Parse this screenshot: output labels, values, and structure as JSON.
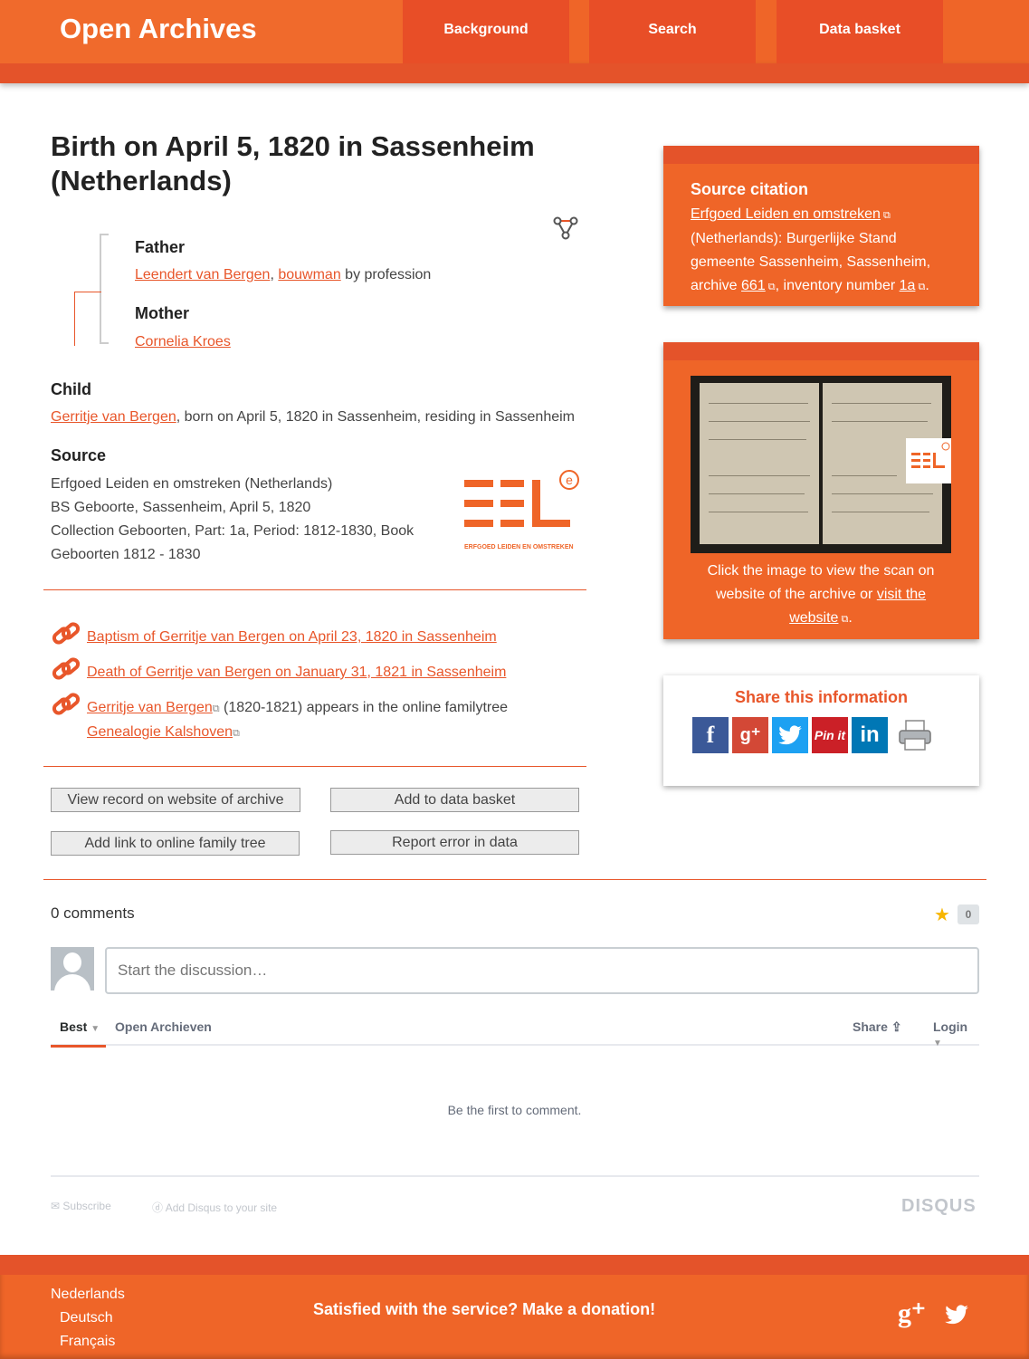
{
  "header": {
    "brand": "Open Archives",
    "nav": [
      "Background",
      "Search",
      "Data basket"
    ]
  },
  "record": {
    "title": "Birth on April 5, 1820 in Sassenheim (Netherlands)",
    "father_label": "Father",
    "father_name": "Leendert van Bergen",
    "father_sep": ", ",
    "father_profession": "bouwman",
    "father_suffix": " by profession",
    "mother_label": "Mother",
    "mother_name": "Cornelia Kroes",
    "child_label": "Child",
    "child_name": "Gerritje van Bergen",
    "child_suffix": ", born on April 5, 1820 in Sassenheim, residing in Sassenheim",
    "source_label": "Source",
    "source_lines": [
      "Erfgoed Leiden en omstreken (Netherlands)",
      "BS Geboorte, Sassenheim, April 5, 1820",
      "Collection Geboorten, Part: 1a, Period: 1812-1830, Book",
      "Geboorten 1812 - 1830"
    ],
    "logo_text": "ERFGOED LEIDEN EN OMSTREKEN"
  },
  "related": [
    {
      "link": "Baptism of Gerritje van Bergen on April 23, 1820 in Sassenheim"
    },
    {
      "link": "Death of Gerritje van Bergen on January 31, 1821 in Sassenheim"
    },
    {
      "link": "Gerritje van Bergen",
      "middle": " (1820-1821) appears in the online familytree",
      "link2": "Genealogie Kalshoven"
    }
  ],
  "buttons": {
    "view_record": "View record on website of archive",
    "add_basket": "Add to data basket",
    "add_link": "Add link to online family tree",
    "report_error": "Report error in data"
  },
  "citation": {
    "heading": "Source citation",
    "archive_link": "Erfgoed Leiden en omstreken",
    "text1": "(Netherlands): Burgerlijke Stand gemeente Sassenheim, Sassenheim, archive ",
    "archive_number": "661",
    "text2": ", inventory number ",
    "inventory_number": "1a",
    "text3": "."
  },
  "scan": {
    "caption_pre": "Click the image to view the scan on website of the archive or ",
    "caption_link": "visit the website",
    "caption_post": "."
  },
  "share": {
    "title": "Share this information",
    "networks": [
      "facebook",
      "google-plus",
      "twitter",
      "pinterest",
      "linkedin",
      "print"
    ]
  },
  "comments": {
    "count_label": "0 comments",
    "star_count": "0",
    "placeholder": "Start the discussion…",
    "tab_best": "Best",
    "tab_community": "Open Archieven",
    "share_label": "Share",
    "login_label": "Login",
    "empty": "Be the first to comment.",
    "subscribe": "Subscribe",
    "add_disqus": "Add Disqus to your site",
    "disqus_logo": "DISQUS"
  },
  "footer": {
    "languages": [
      "Nederlands",
      "Deutsch",
      "Français"
    ],
    "donate": "Satisfied with the service? Make a donation!"
  },
  "colors": {
    "brand_orange": "#ef6528",
    "dark_orange": "#e4532a",
    "link": "#e8562a"
  }
}
